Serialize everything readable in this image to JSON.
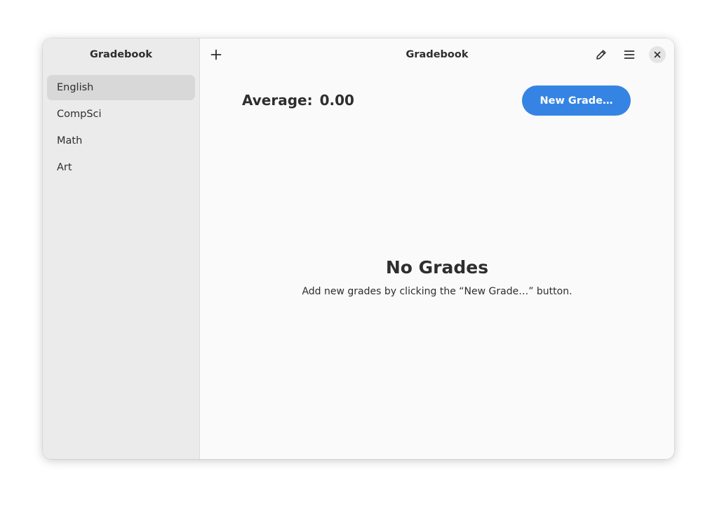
{
  "sidebar": {
    "title": "Gradebook",
    "items": [
      {
        "label": "English",
        "selected": true
      },
      {
        "label": "CompSci",
        "selected": false
      },
      {
        "label": "Math",
        "selected": false
      },
      {
        "label": "Art",
        "selected": false
      }
    ]
  },
  "headerbar": {
    "title": "Gradebook",
    "icons": [
      "add-icon",
      "edit-icon",
      "menu-icon",
      "close-icon"
    ]
  },
  "main": {
    "average_label": "Average:",
    "average_value": "0.00",
    "new_grade_label": "New Grade…",
    "empty_title": "No Grades",
    "empty_description": "Add new grades by clicking the “New Grade…” button."
  },
  "colors": {
    "accent": "#3584e4",
    "sidebar_bg": "#ebebeb",
    "content_bg": "#fafafa",
    "selected_bg": "#d8d8d8"
  }
}
